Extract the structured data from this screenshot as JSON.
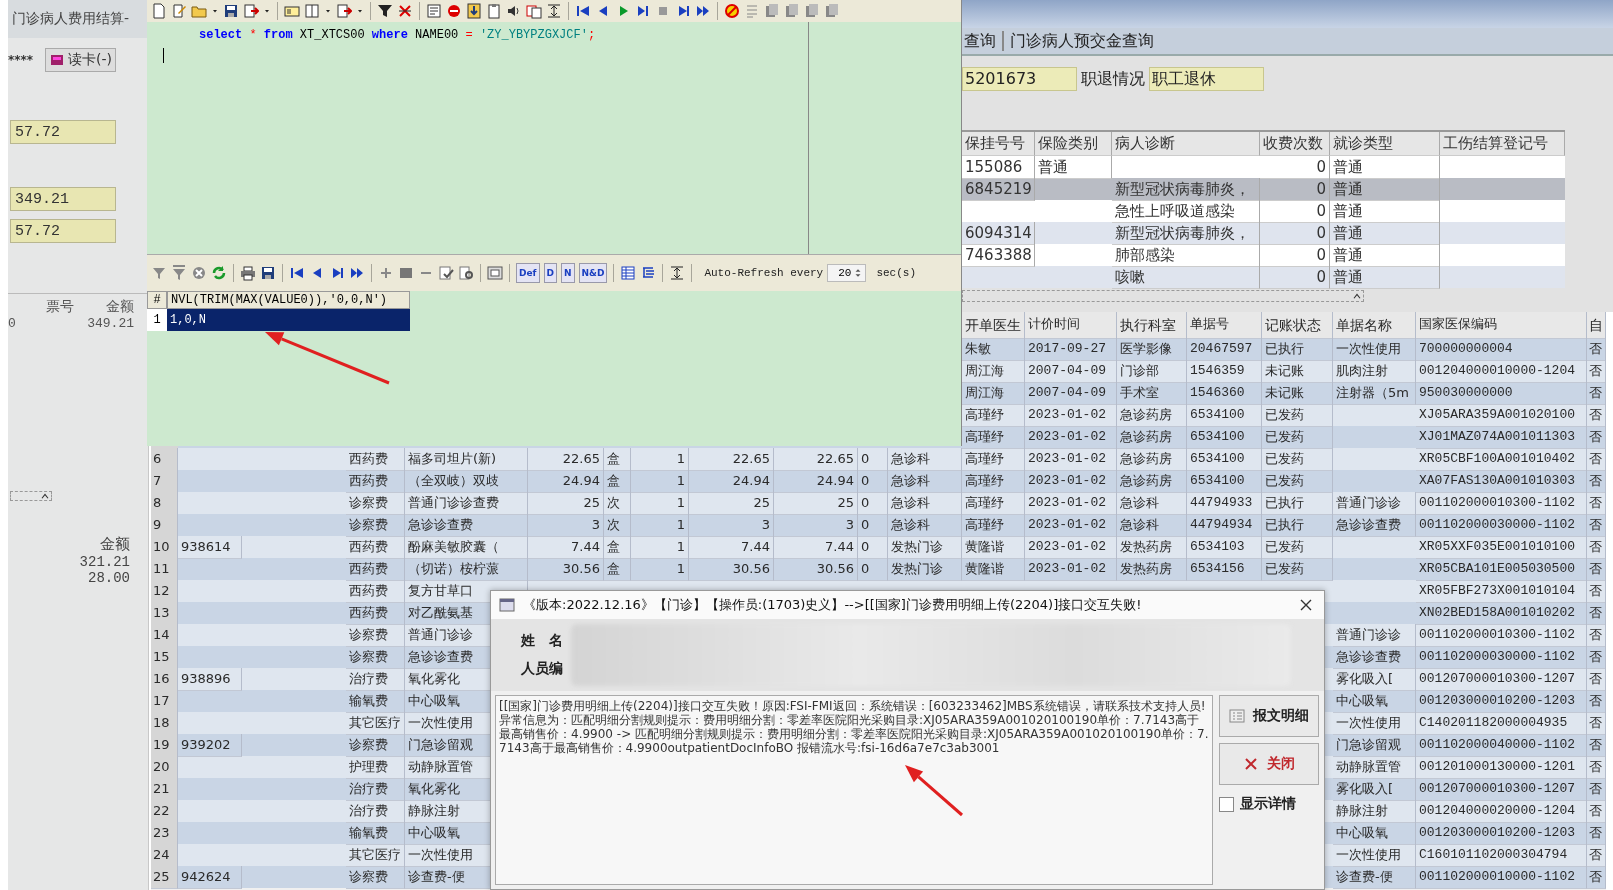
{
  "background_window": {
    "title": "门诊病人费用结算-",
    "masked_field": "****",
    "read_card_button": "读卡(-)",
    "amount_fields": [
      "57.72",
      "349.21",
      "57.72"
    ],
    "invoice_table": {
      "columns": [
        "票号",
        "金额"
      ],
      "rows": [
        [
          "0",
          "349.21"
        ]
      ]
    },
    "totals_table": {
      "column": "金额",
      "values": [
        "321.21",
        "28.00"
      ]
    }
  },
  "sql_editor": {
    "code_tokens": [
      {
        "kind": "keyword",
        "text": "select"
      },
      {
        "kind": "operator",
        "text": "*"
      },
      {
        "kind": "keyword",
        "text": "from"
      },
      {
        "kind": "identifier",
        "text": "XT_XTCS00"
      },
      {
        "kind": "keyword",
        "text": "where"
      },
      {
        "kind": "identifier",
        "text": "NAME00"
      },
      {
        "kind": "operator",
        "text": "="
      },
      {
        "kind": "string",
        "text": "'ZY_YBYPZGXJCF'"
      },
      {
        "kind": "terminator",
        "text": ";"
      }
    ],
    "toolbar_text_buttons": [
      "Def",
      "D",
      "N",
      "N&D"
    ],
    "refresh": {
      "label": "Auto-Refresh every",
      "value": "20",
      "unit": "sec(s)"
    },
    "result_grid": {
      "columns": [
        "#",
        "NVL(TRIM(MAX(VALUE0)),'0,0,N')"
      ],
      "rows": [
        {
          "number": "1",
          "value": "1,0,N",
          "selected": true
        }
      ]
    }
  },
  "query_window": {
    "tabs": [
      {
        "label": "查询"
      },
      {
        "label": "门诊病人预交金查询"
      }
    ],
    "id_field": "5201673",
    "status_label": "职退情况",
    "status_field": "职工退休",
    "table": {
      "columns": [
        "保挂号号",
        "保险类别",
        "病人诊断",
        "收费次数",
        "就诊类型",
        "工伤结算登记号"
      ],
      "rows": [
        {
          "cells": [
            "155086",
            "普通",
            "",
            "0",
            "普通",
            ""
          ],
          "selected": false
        },
        {
          "cells": [
            "6845219",
            "",
            "新型冠状病毒肺炎，",
            "0",
            "普通",
            ""
          ],
          "selected": true
        },
        {
          "cells": [
            "",
            "",
            "急性上呼吸道感染",
            "0",
            "普通",
            ""
          ],
          "selected": false
        },
        {
          "cells": [
            "6094314",
            "",
            "新型冠状病毒肺炎，",
            "0",
            "普通",
            ""
          ],
          "selected": false
        },
        {
          "cells": [
            "7463388",
            "",
            "肺部感染",
            "0",
            "普通",
            ""
          ],
          "selected": false
        },
        {
          "cells": [
            "",
            "",
            "咳嗽",
            "0",
            "普通",
            ""
          ],
          "selected": false
        }
      ]
    }
  },
  "fee_table": {
    "columns": {
      "doctor": "开单医生",
      "priced_at": "计价时间",
      "exec_dept": "执行科室",
      "bill_no": "单据号",
      "bill_status": "记账状态",
      "bill_name": "单据名称",
      "insurance_code": "国家医保编码",
      "column_20": "自"
    },
    "rows": [
      {
        "doctor": "朱敏",
        "priced_at": "2017-09-27",
        "exec_dept": "医学影像",
        "bill_no": "20467597",
        "bill_status": "已执行",
        "bill_name": "一次性使用",
        "insurance_code": "700000000004",
        "column_20": "否"
      },
      {
        "doctor": "周江海",
        "priced_at": "2007-04-09",
        "exec_dept": "门诊部",
        "bill_no": "1546359",
        "bill_status": "未记账",
        "bill_name": "肌肉注射",
        "insurance_code": "001204000010000-1204",
        "column_20": "否"
      },
      {
        "doctor": "周江海",
        "priced_at": "2007-04-09",
        "exec_dept": "手术室",
        "bill_no": "1546360",
        "bill_status": "未记账",
        "bill_name": "注射器（5m",
        "insurance_code": "950030000000",
        "column_20": "否"
      },
      {
        "doctor": "高瑾纾",
        "priced_at": "2023-01-02",
        "exec_dept": "急诊药房",
        "bill_no": "6534100",
        "bill_status": "已发药",
        "insurance_code": "XJ05ARA359A001020100",
        "column_20": "否"
      },
      {
        "doctor": "高瑾纾",
        "priced_at": "2023-01-02",
        "exec_dept": "急诊药房",
        "bill_no": "6534100",
        "bill_status": "已发药",
        "insurance_code": "XJ01MAZ074A001011303",
        "column_20": "否"
      },
      {
        "number": "6",
        "category": "西药费",
        "item_name": "福多司坦片(新)",
        "price": "22.65",
        "unit": "盒",
        "quantity": "1",
        "amount": "22.65",
        "total": "22.65",
        "column_11": "0",
        "department": "急诊科",
        "doctor": "高瑾纾",
        "priced_at": "2023-01-02",
        "exec_dept": "急诊药房",
        "bill_no": "6534100",
        "bill_status": "已发药",
        "insurance_code": "XR05CBF100A001010402",
        "column_20": "否"
      },
      {
        "number": "7",
        "category": "西药费",
        "item_name": "（全双岐）双歧",
        "price": "24.94",
        "unit": "盒",
        "quantity": "1",
        "amount": "24.94",
        "total": "24.94",
        "column_11": "0",
        "department": "急诊科",
        "doctor": "高瑾纾",
        "priced_at": "2023-01-02",
        "exec_dept": "急诊药房",
        "bill_no": "6534100",
        "bill_status": "已发药",
        "insurance_code": "XA07FAS130A001010303",
        "column_20": "否"
      },
      {
        "number": "8",
        "category": "诊察费",
        "item_name": "普通门诊诊查费",
        "price": "25",
        "unit": "次",
        "quantity": "1",
        "amount": "25",
        "total": "25",
        "column_11": "0",
        "department": "急诊科",
        "doctor": "高瑾纾",
        "priced_at": "2023-01-02",
        "exec_dept": "急诊科",
        "bill_no": "44794933",
        "bill_status": "已执行",
        "bill_name": "普通门诊诊",
        "insurance_code": "001102000010300-1102",
        "column_20": "否"
      },
      {
        "number": "9",
        "category": "诊察费",
        "item_name": "急诊诊查费",
        "price": "3",
        "unit": "次",
        "quantity": "1",
        "amount": "3",
        "total": "3",
        "column_11": "0",
        "department": "急诊科",
        "doctor": "高瑾纾",
        "priced_at": "2023-01-02",
        "exec_dept": "急诊科",
        "bill_no": "44794934",
        "bill_status": "已执行",
        "bill_name": "急诊诊查费",
        "insurance_code": "001102000030000-1102",
        "column_20": "否"
      },
      {
        "number": "10",
        "column_2": "938614",
        "category": "西药费",
        "item_name": "酚麻美敏胶囊（",
        "price": "7.44",
        "unit": "盒",
        "quantity": "1",
        "amount": "7.44",
        "total": "7.44",
        "column_11": "0",
        "department": "发热门诊",
        "doctor": "黄隆谐",
        "priced_at": "2023-01-02",
        "exec_dept": "发热药房",
        "bill_no": "6534103",
        "bill_status": "已发药",
        "insurance_code": "XR05XXF035E001010100",
        "column_20": "否"
      },
      {
        "number": "11",
        "category": "西药费",
        "item_name": "（切诺）桉柠蒎",
        "price": "30.56",
        "unit": "盒",
        "quantity": "1",
        "amount": "30.56",
        "total": "30.56",
        "column_11": "0",
        "department": "发热门诊",
        "doctor": "黄隆谐",
        "priced_at": "2023-01-02",
        "exec_dept": "发热药房",
        "bill_no": "6534156",
        "bill_status": "已发药",
        "insurance_code": "XR05CBA101E005030500",
        "column_20": "否"
      },
      {
        "number": "12",
        "category": "西药费",
        "item_name": "复方甘草口",
        "insurance_code": "XR05FBF273X001010104",
        "column_20": "否"
      },
      {
        "number": "13",
        "category": "西药费",
        "item_name": "对乙酰氨基",
        "insurance_code": "XN02BED158A001010202",
        "column_20": "否"
      },
      {
        "number": "14",
        "category": "诊察费",
        "item_name": "普通门诊诊",
        "bill_name": "普通门诊诊",
        "insurance_code": "001102000010300-1102",
        "column_20": "否"
      },
      {
        "number": "15",
        "category": "诊察费",
        "item_name": "急诊诊查费",
        "bill_name": "急诊诊查费",
        "insurance_code": "001102000030000-1102",
        "column_20": "否"
      },
      {
        "number": "16",
        "column_2": "938896",
        "category": "治疗费",
        "item_name": "氧化雾化",
        "bill_name": "雾化吸入[",
        "insurance_code": "001207000010300-1207",
        "column_20": "否"
      },
      {
        "number": "17",
        "category": "输氧费",
        "item_name": "中心吸氧",
        "bill_name": "中心吸氧",
        "insurance_code": "001203000010200-1203",
        "column_20": "否"
      },
      {
        "number": "18",
        "category": "其它医疗",
        "item_name": "一次性使用",
        "bill_name": "一次性使用",
        "insurance_code": "C140201182000004935",
        "column_20": "否"
      },
      {
        "number": "19",
        "column_2": "939202",
        "category": "诊察费",
        "item_name": "门急诊留观",
        "bill_name": "门急诊留观",
        "insurance_code": "001102000040000-1102",
        "column_20": "否"
      },
      {
        "number": "20",
        "category": "护理费",
        "item_name": "动静脉置管",
        "bill_name": "动静脉置管",
        "insurance_code": "001201000130000-1201",
        "column_20": "否"
      },
      {
        "number": "21",
        "category": "治疗费",
        "item_name": "氧化雾化",
        "bill_name": "雾化吸入[",
        "insurance_code": "001207000010300-1207",
        "column_20": "否"
      },
      {
        "number": "22",
        "category": "治疗费",
        "item_name": "静脉注射",
        "bill_name": "静脉注射",
        "insurance_code": "001204000020000-1204",
        "column_20": "否"
      },
      {
        "number": "23",
        "category": "输氧费",
        "item_name": "中心吸氧",
        "bill_name": "中心吸氧",
        "insurance_code": "001203000010200-1203",
        "column_20": "否"
      },
      {
        "number": "24",
        "category": "其它医疗",
        "item_name": "一次性使用",
        "bill_name": "一次性使用",
        "insurance_code": "C160101102000304794",
        "column_20": "否"
      },
      {
        "number": "25",
        "column_2": "942624",
        "category": "诊察费",
        "item_name": "诊查费-便",
        "bill_name": "诊查费-便",
        "insurance_code": "001102000010000-1102",
        "column_20": "否"
      }
    ]
  },
  "error_dialog": {
    "title": "《版本:2022.12.16》【门诊】【操作员:(1703)史义】-->[[国家]门诊费用明细上传(2204)]接口交互失败!",
    "field_labels": [
      "姓　名",
      "人员编"
    ],
    "message": "[[国家]门诊费用明细上传(2204)]接口交互失败！原因:FSI-FMI返回：系统错误：[603233462]MBS系统错误，请联系技术支持人员!异常信息为：匹配明细分割规则提示：费用明细分割：零差率医院阳光采购目录:XJ05ARA359A001020100190单价：7.7143高于最高销售价：4.9900 -> 匹配明细分割规则提示：费用明细分割：零差率医院阳光采购目录:XJ05ARA359A001020100190单价：7.7143高于最高销售价：4.9900outpatientDocInfoBO 报错流水号:fsi-16d6a7e7c3ab3001",
    "buttons": [
      {
        "kind": "detail",
        "label": "报文明细"
      },
      {
        "kind": "close",
        "label": "关闭"
      }
    ],
    "show_details": {
      "label": "显示详情",
      "checked": false
    }
  }
}
